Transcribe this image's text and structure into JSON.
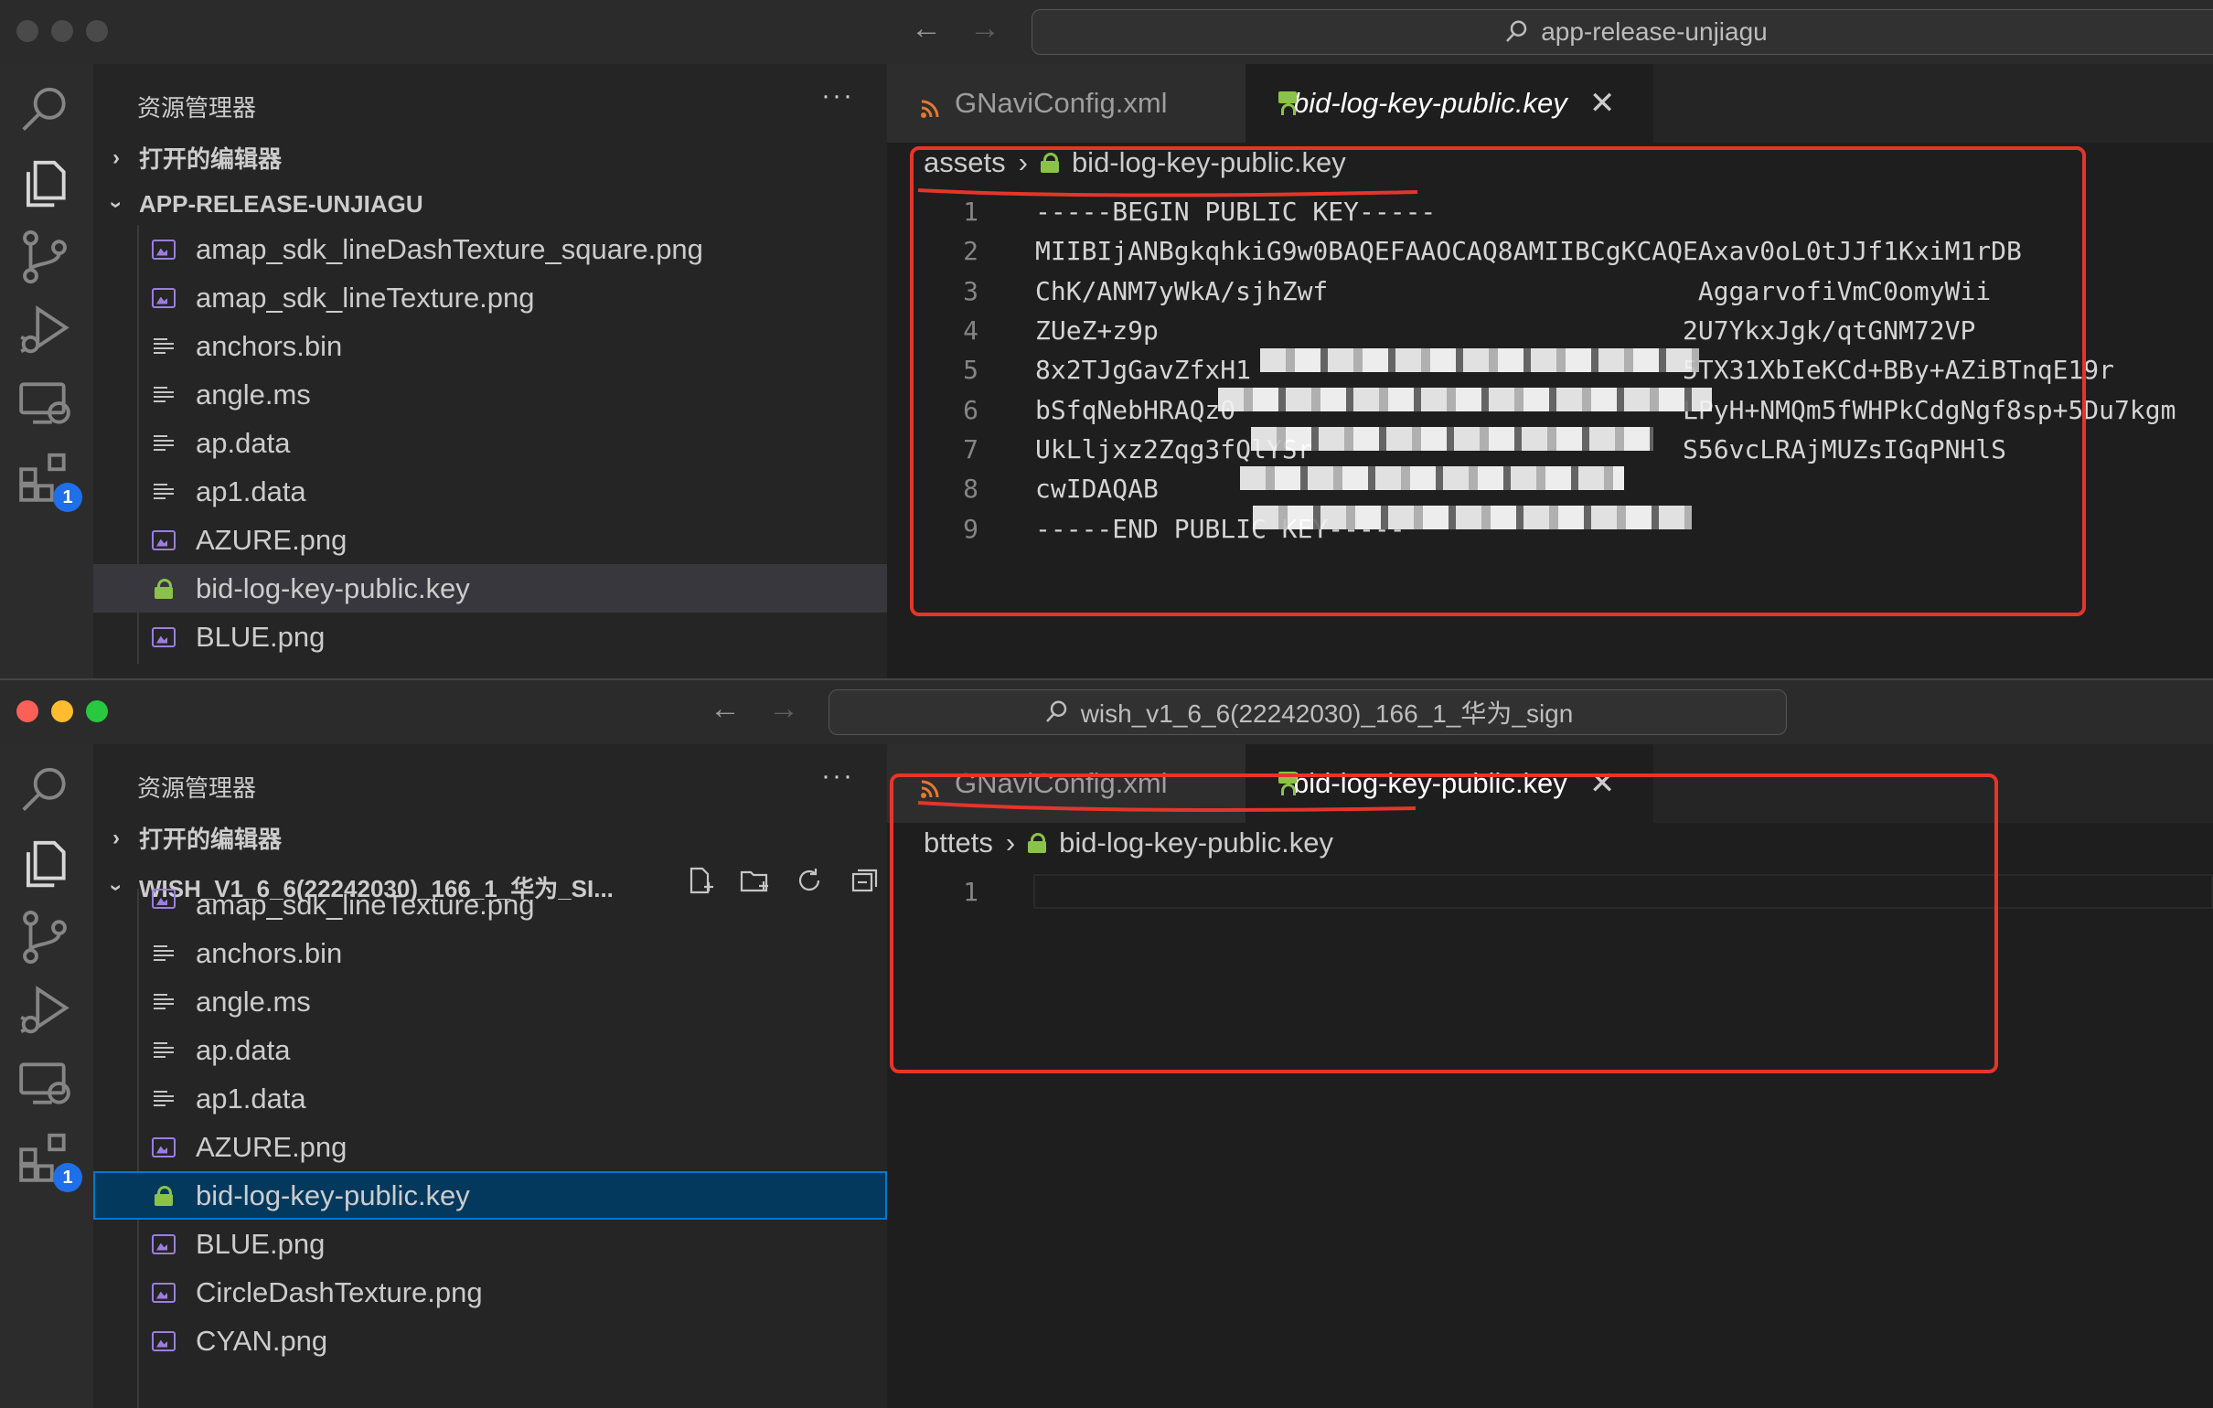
{
  "top": {
    "title": "app-release-unjiagu",
    "explorer_title": "资源管理器",
    "open_editors": "打开的编辑器",
    "folder": "APP-RELEASE-UNJIAGU",
    "files": [
      {
        "name": "amap_sdk_lineDashTexture_square.png",
        "type": "image"
      },
      {
        "name": "amap_sdk_lineTexture.png",
        "type": "image"
      },
      {
        "name": "anchors.bin",
        "type": "file"
      },
      {
        "name": "angle.ms",
        "type": "file"
      },
      {
        "name": "ap.data",
        "type": "file"
      },
      {
        "name": "ap1.data",
        "type": "file"
      },
      {
        "name": "AZURE.png",
        "type": "image"
      },
      {
        "name": "bid-log-key-public.key",
        "type": "key"
      },
      {
        "name": "BLUE.png",
        "type": "image"
      }
    ],
    "tabs": [
      {
        "label": "GNaviConfig.xml"
      },
      {
        "label": "bid-log-key-public.key"
      }
    ],
    "breadcrumb": {
      "folder": "assets",
      "file": "bid-log-key-public.key"
    },
    "lines": [
      {
        "n": "1",
        "text": "-----BEGIN PUBLIC KEY-----"
      },
      {
        "n": "2",
        "text": "MIIBIjANBgkqhkiG9w0BAQEFAAOCAQ8AMIIBCgKCAQEAxav0oL0tJJf1KxiM1rDB"
      },
      {
        "n": "3",
        "text": "ChK/ANM7yWkA/sjhZwf                        AggarvofiVmC0omyWii"
      },
      {
        "n": "4",
        "text": "ZUeZ+z9p                                  2U7YkxJgk/qtGNM72VP"
      },
      {
        "n": "5",
        "text": "8x2TJgGavZfxH1                            5TX31XbIeKCd+BBy+AZiBTnqE19r"
      },
      {
        "n": "6",
        "text": "bSfqNebHRAQz0                             LPyH+NMQm5fWHPkCdgNgf8sp+5Du7kgm"
      },
      {
        "n": "7",
        "text": "UkLljxz2Zqg3fQlYSr                        S56vcLRAjMUZsIGqPNHlS"
      },
      {
        "n": "8",
        "text": "cwIDAQAB"
      },
      {
        "n": "9",
        "text": "-----END PUBLIC KEY-----"
      }
    ]
  },
  "bottom": {
    "title": "wish_v1_6_6(22242030)_166_1_华为_sign",
    "explorer_title": "资源管理器",
    "open_editors": "打开的编辑器",
    "folder": "WISH_V1_6_6(22242030)_166_1_华为_SI...",
    "files": [
      {
        "name": "amap_sdk_lineTexture.png",
        "type": "image"
      },
      {
        "name": "anchors.bin",
        "type": "file"
      },
      {
        "name": "angle.ms",
        "type": "file"
      },
      {
        "name": "ap.data",
        "type": "file"
      },
      {
        "name": "ap1.data",
        "type": "file"
      },
      {
        "name": "AZURE.png",
        "type": "image"
      },
      {
        "name": "bid-log-key-public.key",
        "type": "key"
      },
      {
        "name": "BLUE.png",
        "type": "image"
      },
      {
        "name": "CircleDashTexture.png",
        "type": "image"
      },
      {
        "name": "CYAN.png",
        "type": "image"
      }
    ],
    "tabs": [
      {
        "label": "GNaviConfig.xml"
      },
      {
        "label": "bid-log-key-public.key"
      }
    ],
    "breadcrumb": {
      "folder": "bttets",
      "file": "bid-log-key-public.key"
    },
    "lines": [
      {
        "n": "1",
        "text": ""
      }
    ]
  },
  "badge_count": "1",
  "colors": {
    "annotation": "#e5352a",
    "accent": "#0078d4",
    "lock": "#8bc34a",
    "image_icon": "#9b7ede",
    "rss": "#e37933"
  },
  "icons": [
    "search-icon",
    "explorer-icon",
    "source-control-icon",
    "run-debug-icon",
    "remote-explorer-icon",
    "extensions-icon"
  ]
}
